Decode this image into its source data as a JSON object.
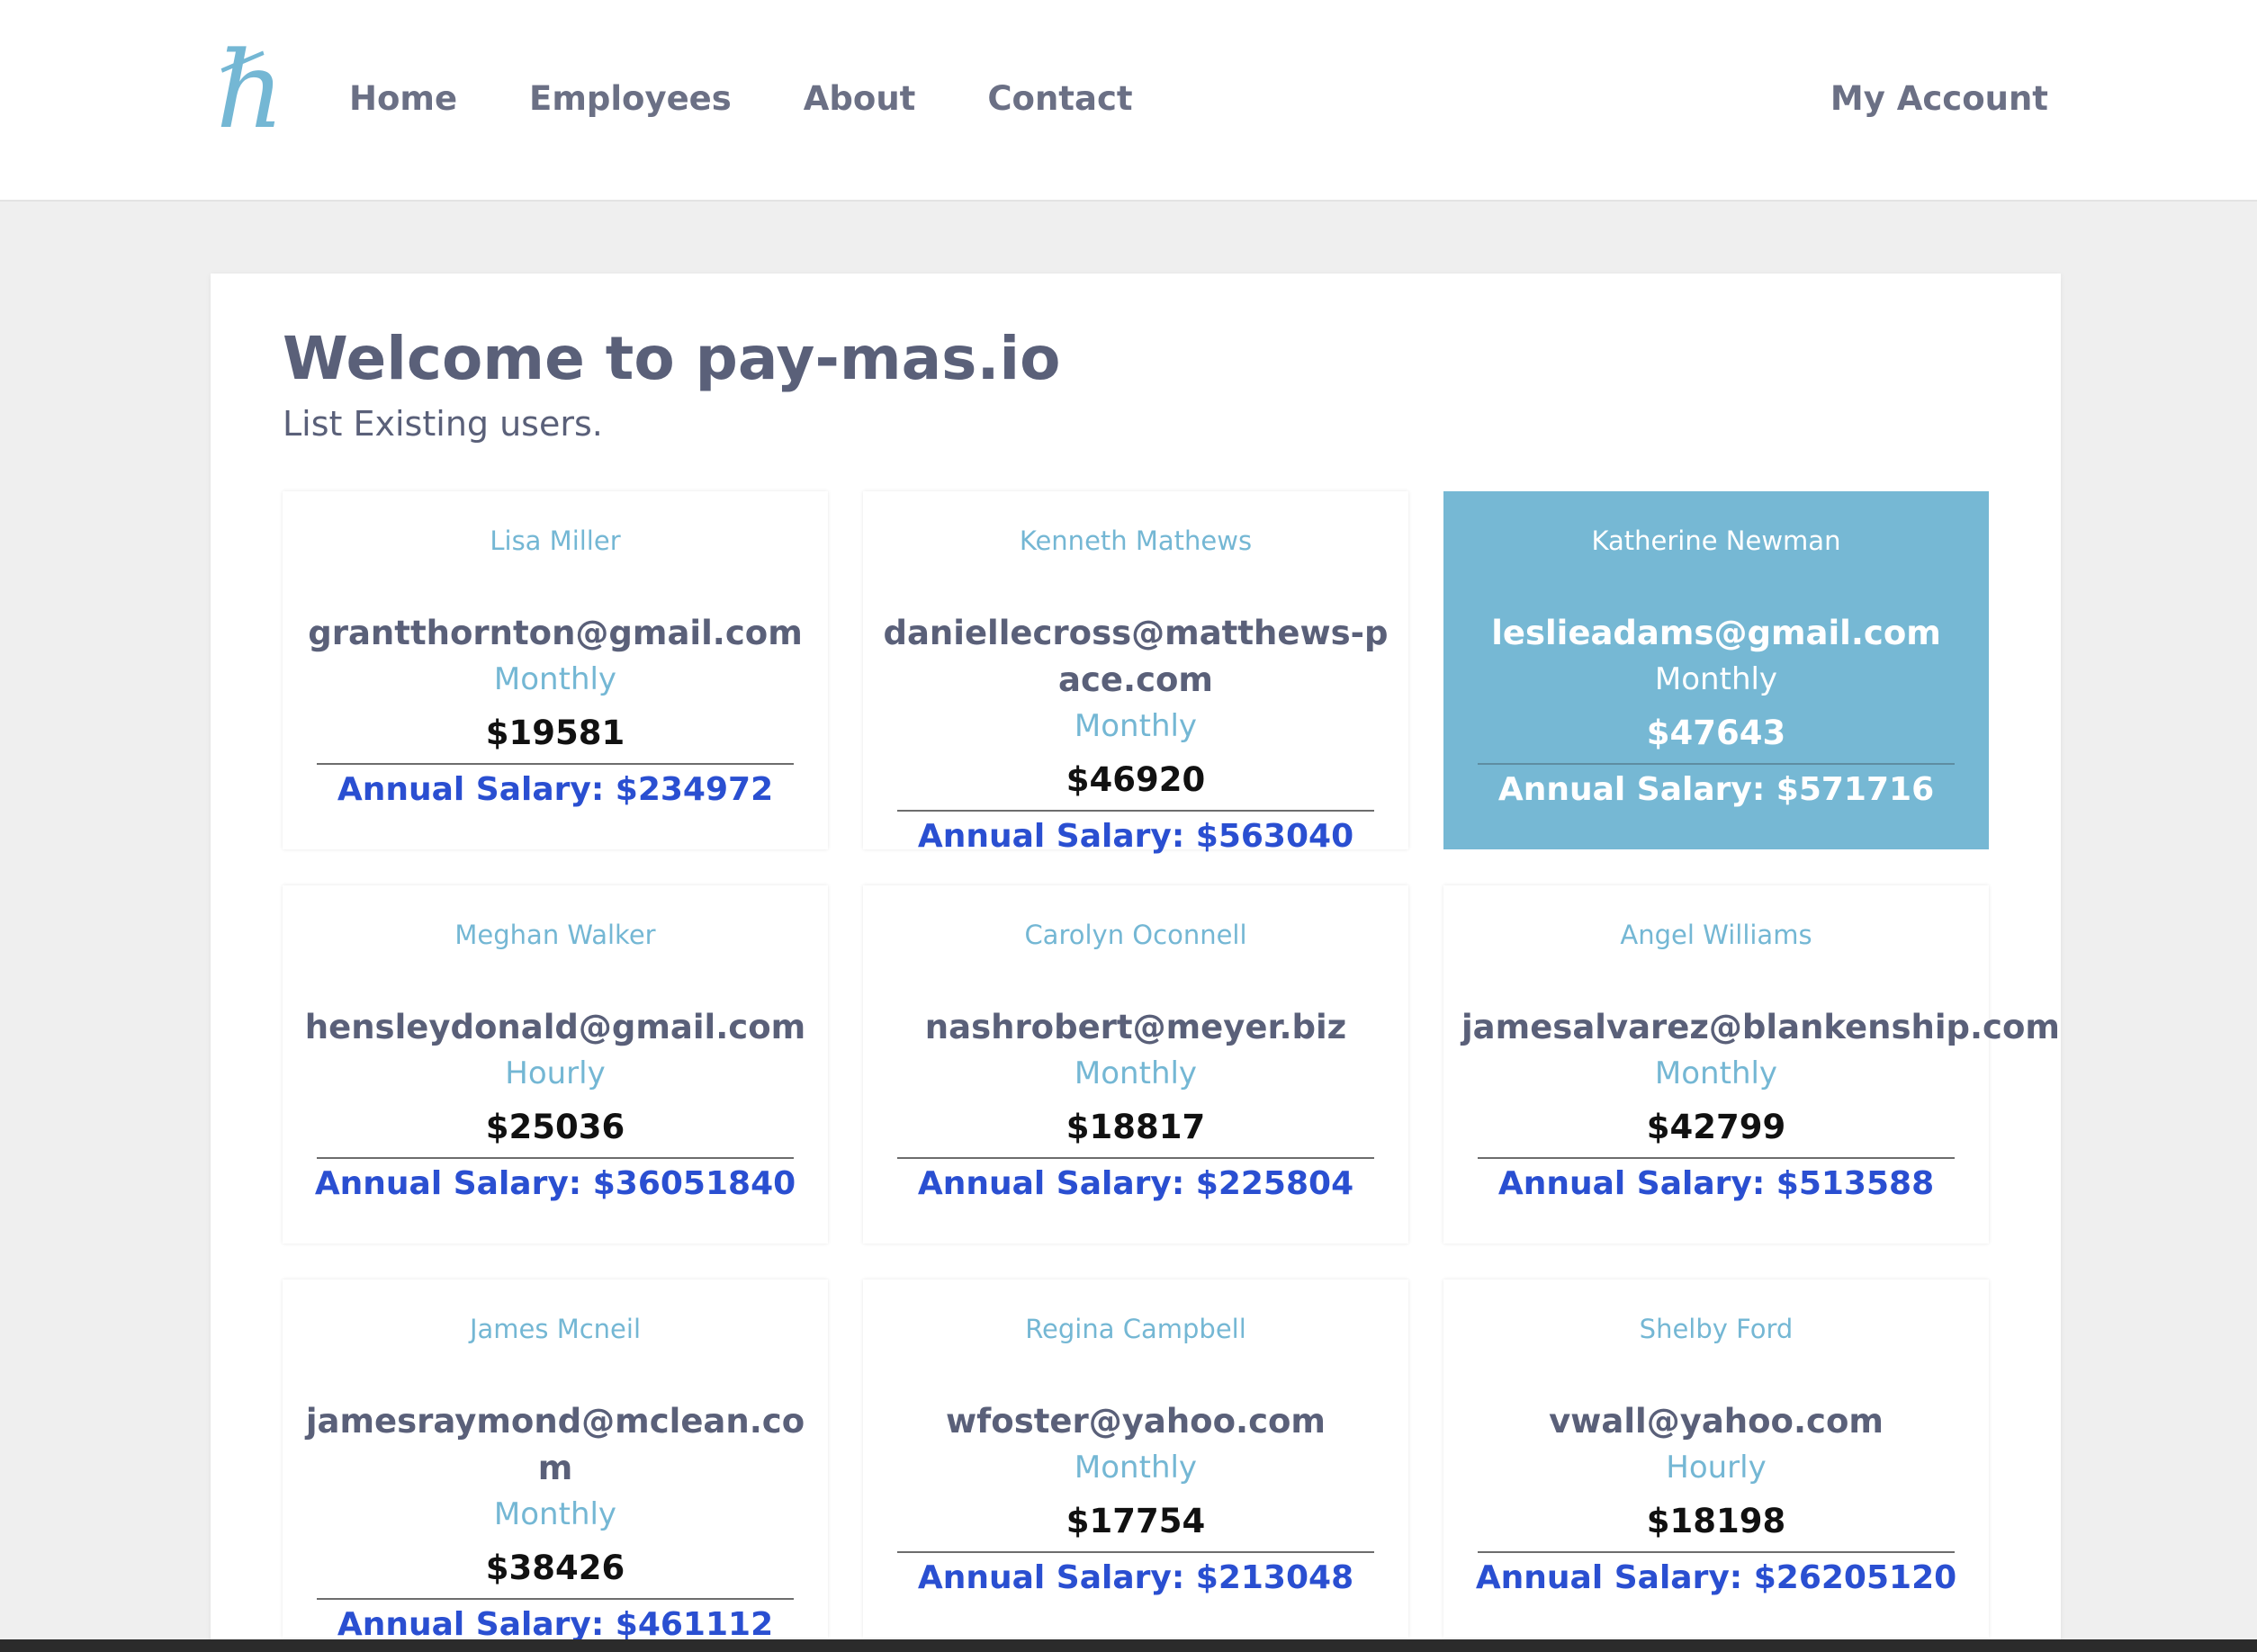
{
  "header": {
    "logo_glyph": "ℏ",
    "nav": [
      {
        "label": "Home"
      },
      {
        "label": "Employees"
      },
      {
        "label": "About"
      },
      {
        "label": "Contact"
      }
    ],
    "account_label": "My Account"
  },
  "main": {
    "title": "Welcome to pay-mas.io",
    "subtitle": "List Existing users."
  },
  "colors": {
    "accent": "#74b7d4",
    "active_card": "#76b8d4",
    "annual_text": "#2a4fd1",
    "body_text": "#5a6079",
    "page_bg": "#efefef"
  },
  "employees": [
    {
      "name": "Lisa Miller",
      "email": "grantthornton@gmail.com",
      "frequency": "Monthly",
      "amount": "$19581",
      "annual": "Annual Salary: $234972",
      "selected": false
    },
    {
      "name": "Kenneth Mathews",
      "email": "daniellecross@matthews-pace.com",
      "frequency": "Monthly",
      "amount": "$46920",
      "annual": "Annual Salary: $563040",
      "selected": false
    },
    {
      "name": "Katherine Newman",
      "email": "leslieadams@gmail.com",
      "frequency": "Monthly",
      "amount": "$47643",
      "annual": "Annual Salary: $571716",
      "selected": true
    },
    {
      "name": "Meghan Walker",
      "email": "hensleydonald@gmail.com",
      "frequency": "Hourly",
      "amount": "$25036",
      "annual": "Annual Salary: $36051840",
      "selected": false
    },
    {
      "name": "Carolyn Oconnell",
      "email": "nashrobert@meyer.biz",
      "frequency": "Monthly",
      "amount": "$18817",
      "annual": "Annual Salary: $225804",
      "selected": false
    },
    {
      "name": "Angel Williams",
      "email": "jamesalvarez@blankenship.com",
      "frequency": "Monthly",
      "amount": "$42799",
      "annual": "Annual Salary: $513588",
      "selected": false
    },
    {
      "name": "James Mcneil",
      "email": "jamesraymond@mclean.com",
      "frequency": "Monthly",
      "amount": "$38426",
      "annual": "Annual Salary: $461112",
      "selected": false
    },
    {
      "name": "Regina Campbell",
      "email": "wfoster@yahoo.com",
      "frequency": "Monthly",
      "amount": "$17754",
      "annual": "Annual Salary: $213048",
      "selected": false
    },
    {
      "name": "Shelby Ford",
      "email": "vwall@yahoo.com",
      "frequency": "Hourly",
      "amount": "$18198",
      "annual": "Annual Salary: $26205120",
      "selected": false
    }
  ]
}
